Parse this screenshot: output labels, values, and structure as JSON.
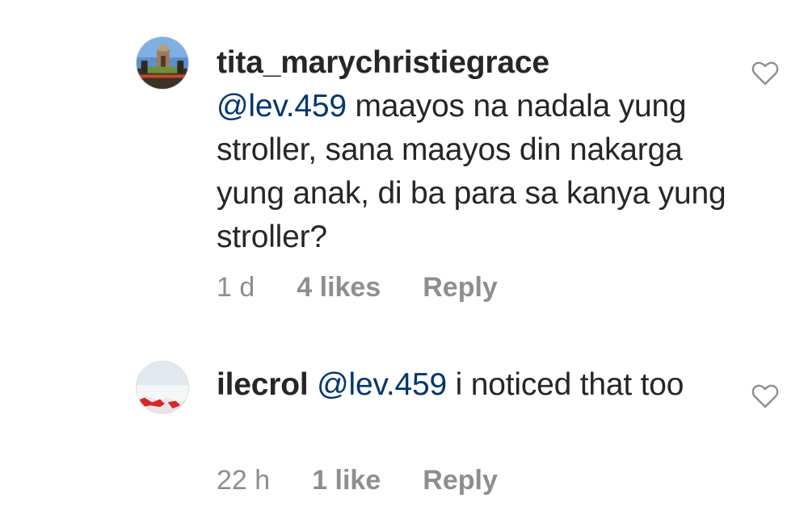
{
  "comments": [
    {
      "username": "tita_marychristiegrace",
      "mention": "@lev.459",
      "text": " maayos na nadala yung stroller, sana maayos din nakarga yung anak, di ba para sa kanya yung stroller?",
      "time": "1 d",
      "likes": "4 likes",
      "reply": "Reply",
      "avatar_icon": "avatar-landscape-photo",
      "like_icon": "heart-outline-icon"
    },
    {
      "username": "ilecrol",
      "mention": "@lev.459",
      "text": " i noticed that too",
      "time": "22 h",
      "likes": "1 like",
      "reply": "Reply",
      "avatar_icon": "avatar-snow-photo",
      "like_icon": "heart-outline-icon"
    }
  ],
  "colors": {
    "text": "#262626",
    "mention": "#00376b",
    "meta": "#8e8e8e",
    "background": "#ffffff"
  }
}
